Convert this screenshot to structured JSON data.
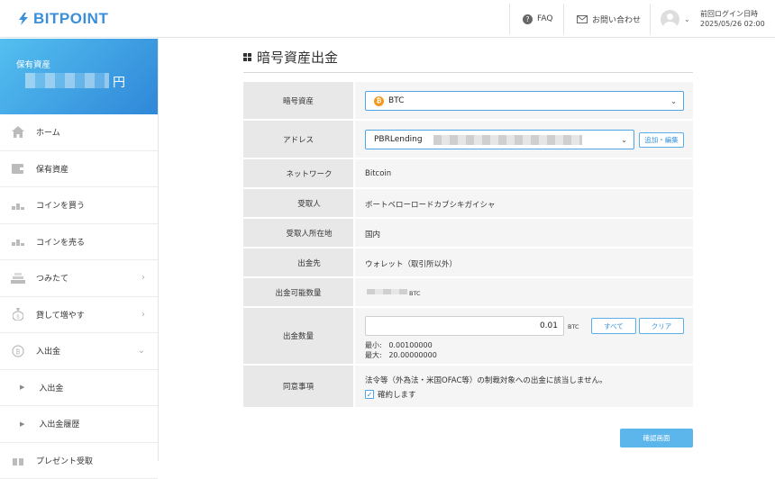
{
  "header": {
    "logo_text": "BITPOINT",
    "faq_label": "FAQ",
    "contact_label": "お問い合わせ",
    "last_login_label": "前回ログイン日時",
    "last_login_value": "2025/05/26 02:00"
  },
  "sidebar": {
    "assets_label": "保有資産",
    "currency_suffix": "円",
    "items": [
      {
        "label": "ホーム",
        "icon": "home-icon"
      },
      {
        "label": "保有資産",
        "icon": "wallet-icon"
      },
      {
        "label": "コインを買う",
        "icon": "buy-coins-icon"
      },
      {
        "label": "コインを売る",
        "icon": "sell-coins-icon"
      },
      {
        "label": "つみたて",
        "icon": "accumulate-icon",
        "chevron": "›"
      },
      {
        "label": "貸して増やす",
        "icon": "lending-bag-icon",
        "chevron": "›"
      },
      {
        "label": "入出金",
        "icon": "deposit-withdraw-icon",
        "chevron": "⌄"
      }
    ],
    "sub_items": [
      {
        "label": "入出金"
      },
      {
        "label": "入出金履歴"
      }
    ],
    "partial_item": {
      "label": "プレゼント受取"
    }
  },
  "page": {
    "title": "暗号資産出金"
  },
  "form": {
    "asset_label": "暗号資産",
    "asset_value": "BTC",
    "address_label": "アドレス",
    "address_value": "PBRLending",
    "add_edit_button": "追加・編集",
    "network_label": "ネットワーク",
    "network_value": "Bitcoin",
    "recipient_label": "受取人",
    "recipient_value": "ボートベローロードカブシキガイシャ",
    "recipient_location_label": "受取人所在地",
    "recipient_location_value": "国内",
    "destination_label": "出金先",
    "destination_value": "ウォレット（取引所以外）",
    "available_label": "出金可能数量",
    "available_unit": "BTC",
    "amount_label": "出金数量",
    "amount_value": "0.01",
    "amount_unit": "BTC",
    "all_button": "すべて",
    "clear_button": "クリア",
    "min_label": "最小:",
    "min_value": "0.00100000",
    "max_label": "最大:",
    "max_value": "20.00000000",
    "consent_label": "同意事項",
    "consent_text": "法令等（外為法・米国OFAC等）の制裁対象への出金に該当しません。",
    "consent_check_label": "確約します",
    "consent_checked": true
  },
  "confirm_button": "確認画面",
  "colors": {
    "brand": "#3b8fd9",
    "assets_gradient_start": "#54bff0",
    "assets_gradient_end": "#2f87d8",
    "confirm_button": "#5cb6ec",
    "btc_orange": "#f39a1e"
  }
}
